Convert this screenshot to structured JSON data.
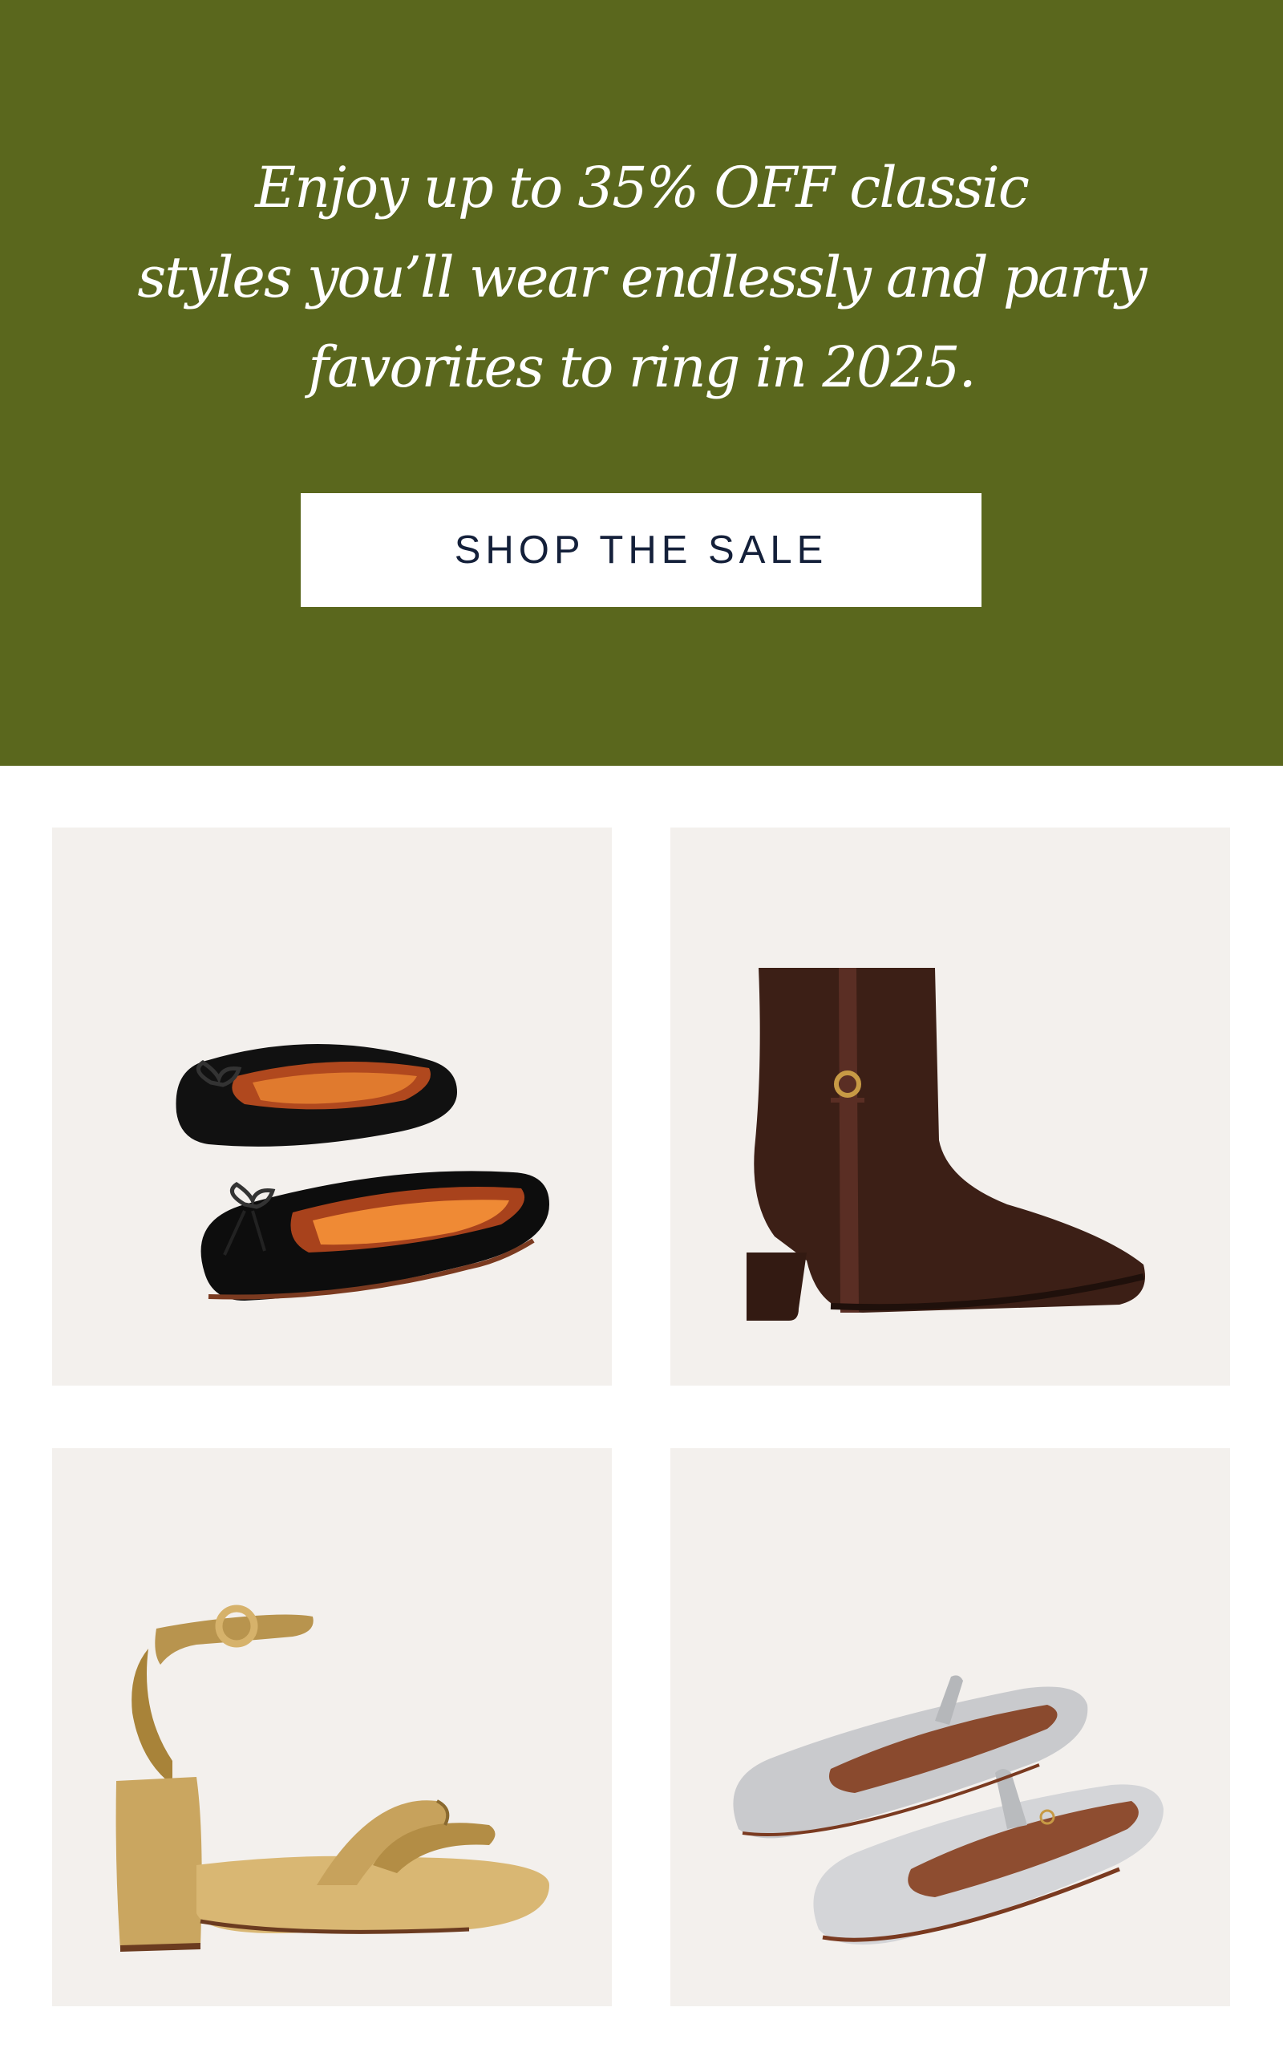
{
  "hero": {
    "background_color": "#5a671d",
    "headline_lines": [
      "Enjoy up to 35% OFF classic",
      "styles you’ll wear endlessly and party",
      "favorites to ring in 2025."
    ],
    "cta_label": "SHOP THE SALE"
  },
  "products": [
    {
      "name": "black leather ballet flats with bow",
      "icon": "ballet-flats-image"
    },
    {
      "name": "brown suede ankle boot with buckle",
      "icon": "ankle-boot-image"
    },
    {
      "name": "gold metallic platform sandal",
      "icon": "platform-sandal-image"
    },
    {
      "name": "silver metallic mary jane flats",
      "icon": "mary-jane-image"
    }
  ]
}
